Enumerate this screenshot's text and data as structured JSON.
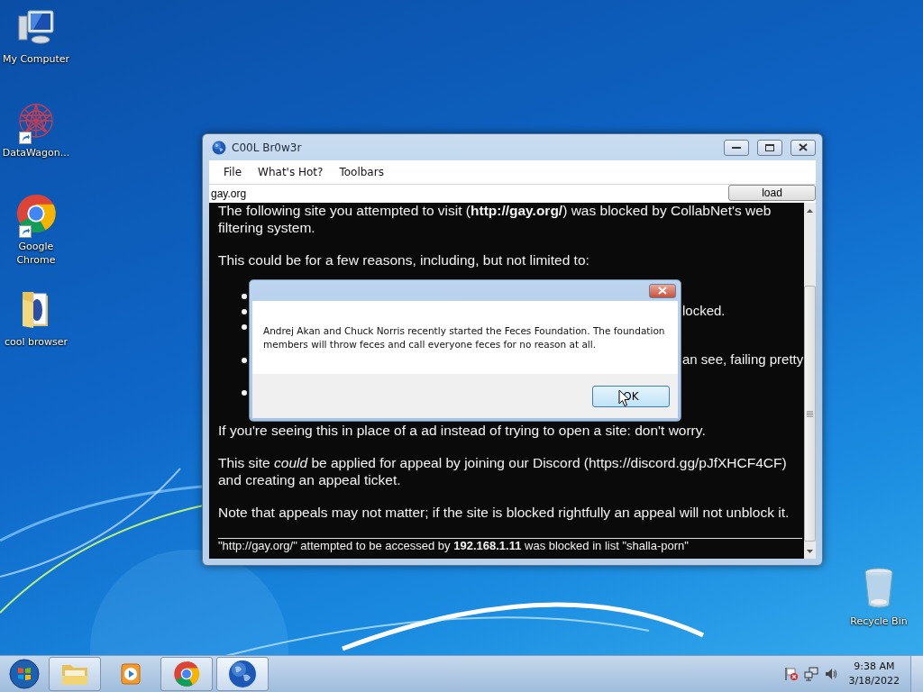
{
  "desktop_icons": [
    {
      "kind": "computer",
      "label": "My Computer",
      "shortcut": false
    },
    {
      "kind": "datawagon",
      "label": "DataWagon...",
      "shortcut": true
    },
    {
      "kind": "chrome",
      "label": "Google Chrome",
      "shortcut": true
    },
    {
      "kind": "folder",
      "label": "cool browser",
      "shortcut": false
    },
    {
      "kind": "recycle",
      "label": "Recycle Bin",
      "shortcut": false
    }
  ],
  "window": {
    "title": "C00L Br0w3r",
    "menu": [
      "File",
      "What's Hot?",
      "Toolbars"
    ],
    "address": {
      "value": "gay.org"
    },
    "load_button": "load",
    "page": {
      "intro": "The following site you attempted to visit (**http://gay.org/**) was blocked by CollabNet's web filtering system.",
      "reasons_intro": "This could be for a few reasons, including, but not limited to:",
      "bullets": [
        {
          "kind": "covered"
        },
        {
          "kind": "tail",
          "text": "locked."
        },
        {
          "kind": "covered"
        },
        {
          "kind": "tail",
          "text": "an see, failing pretty"
        },
        {
          "kind": "covered"
        }
      ],
      "paragraphs": [
        "If you're seeing this in place of a ad instead of trying to open a site: don't worry.",
        "This site *could* be applied for appeal by joining our Discord (https://discord.gg/pJfXHCF4CF) and creating an appeal ticket.",
        "Note that appeals may not matter; if the site is blocked rightfully an appeal will not unblock it."
      ],
      "footer": "\"http://gay.org/\" attempted to be accessed by **192.168.1.11** was blocked in list \"shalla-porn\""
    }
  },
  "dialog": {
    "message": "Andrej Akan and Chuck Norris recently started the Feces Foundation. The foundation members will throw feces and call everyone feces for no reason at all.",
    "ok_button": "OK"
  },
  "taskbar": {
    "items": [
      {
        "kind": "explorer",
        "open": true,
        "selected": false
      },
      {
        "kind": "media",
        "open": false,
        "selected": false
      },
      {
        "kind": "chrome",
        "open": true,
        "selected": false
      },
      {
        "kind": "globe",
        "open": true,
        "selected": true
      }
    ],
    "time": "9:38 AM",
    "date": "3/18/2022"
  }
}
